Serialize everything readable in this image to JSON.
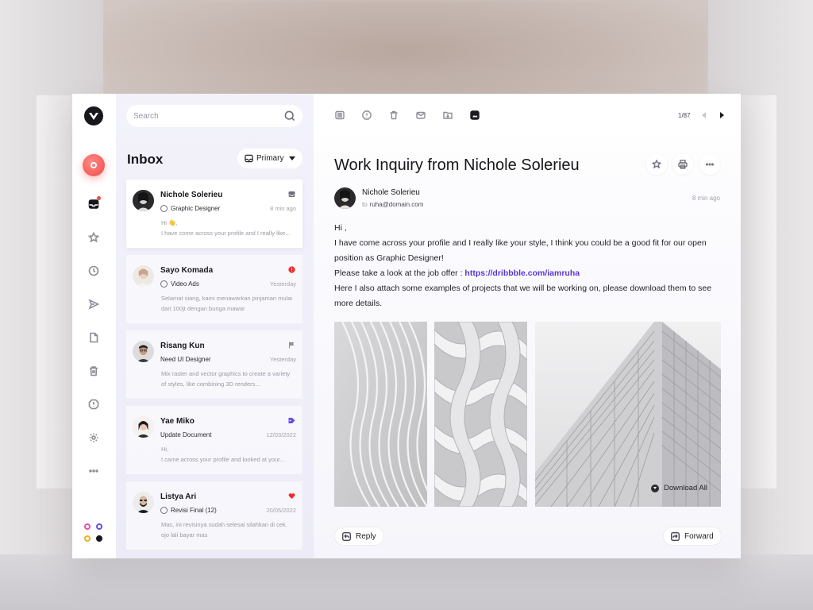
{
  "search": {
    "placeholder": "Search"
  },
  "inbox": {
    "title": "Inbox",
    "filter_label": "Primary",
    "mails": [
      {
        "name": "Nichole Solerieu",
        "tag": "Graphic Designer",
        "time": "8 min ago",
        "preview_line1": "Hi 👋,",
        "preview_line2": "I have come across your profile and I really like...",
        "flag_icon": "inbox-icon",
        "selected": true
      },
      {
        "name": "Sayo Komada",
        "tag": "Video Ads",
        "time": "Yesterday",
        "preview_line1": "Selamat siang, kami menawarkan pinjaman mulai",
        "preview_line2": "dari 100jt dengan bunga mawar",
        "flag_icon": "alert-icon"
      },
      {
        "name": "Risang Kun",
        "tag": "Need UI Designer",
        "time": "Yesterday",
        "preview_line1": "Mix raster and vector graphics to create a variety",
        "preview_line2": "of styles, like combining 3D renders...",
        "flag_icon": "flag-icon"
      },
      {
        "name": "Yae Miko",
        "tag": "Update Document",
        "time": "12/03/2022",
        "preview_line1": "Hi,",
        "preview_line2": "I came across your profile and looked at your...",
        "flag_icon": "tag-icon"
      },
      {
        "name": "Listya Ari",
        "tag": "Revisi Final (12)",
        "time": "20/05/2022",
        "preview_line1": "Mas, ini revisinya sudah selesai silahkan di cek.",
        "preview_line2": "ojo lali bayar mas",
        "flag_icon": "heart-icon"
      }
    ]
  },
  "toolbar": {
    "pager": "1/87"
  },
  "message": {
    "subject": "Work Inquiry from Nichole Solerieu",
    "sender_name": "Nichole Solerieu",
    "to_label": "to",
    "to_address": "ruha@domain.com",
    "time": "8 min ago",
    "greeting": "Hi ,",
    "para1": "I have come across your profile and I really like your style, I think you could be a good fit for our open position as Graphic Designer!",
    "offer_prefix": "Please take a look at the job offer : ",
    "offer_link": "https://dribbble.com/iamruha",
    "para2": "Here I also attach some examples of projects that we will be working on, please download them to see more details.",
    "download_all": "Download All",
    "reply_label": "Reply",
    "forward_label": "Forward"
  },
  "colors": {
    "accent_red": "#ef4a47",
    "link_purple": "#5a34d0",
    "panel_bg": "#f0eff9",
    "dot_pink": "#e84fa6",
    "dot_purple": "#6b4de6",
    "dot_yellow": "#f2b21a",
    "dot_black": "#17171c"
  }
}
